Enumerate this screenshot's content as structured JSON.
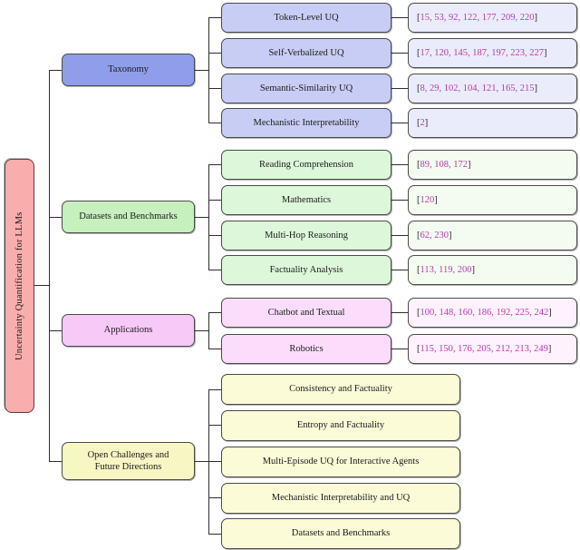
{
  "root": {
    "label": "Uncertainty Quantification for LLMs",
    "color": "#f9adad"
  },
  "categories": [
    {
      "id": "taxonomy",
      "label": "Taxonomy",
      "color": "#8e9ee8",
      "leaf_color": "#c8cdf5",
      "cite_color": "#eaecfb",
      "children": [
        {
          "label": "Token-Level UQ",
          "citations": "[15, 53, 92, 122, 177, 209, 220]"
        },
        {
          "label": "Self-Verbalized UQ",
          "citations": "[17, 120, 145, 187, 197, 223, 227]"
        },
        {
          "label": "Semantic-Similarity UQ",
          "citations": "[8, 29, 102, 104, 121, 165, 215]"
        },
        {
          "label": "Mechanistic Interpretability",
          "citations": "[2]"
        }
      ]
    },
    {
      "id": "datasets",
      "label": "Datasets and Benchmarks",
      "color": "#c6f0bd",
      "leaf_color": "#ddf7da",
      "cite_color": "#f4fcf2",
      "children": [
        {
          "label": "Reading Comprehension",
          "citations": "[89, 108, 172]"
        },
        {
          "label": "Mathematics",
          "citations": "[120]"
        },
        {
          "label": "Multi-Hop Reasoning",
          "citations": "[62, 230]"
        },
        {
          "label": "Factuality Analysis",
          "citations": "[113, 119, 200]"
        }
      ]
    },
    {
      "id": "applications",
      "label": "Applications",
      "color": "#f7c9f7",
      "leaf_color": "#fbddfb",
      "cite_color": "#fdf2fd",
      "children": [
        {
          "label": "Chatbot and Textual",
          "citations": "[100, 148, 160, 186, 192, 225, 242]"
        },
        {
          "label": "Robotics",
          "citations": "[115, 150, 176, 205, 212, 213, 249]"
        }
      ]
    },
    {
      "id": "open_challenges",
      "label": "Open Challenges and\nFuture Directions",
      "label_line1": "Open Challenges and",
      "label_line2": "Future Directions",
      "color": "#f7f7c4",
      "leaf_color": "#fbfbd8",
      "children": [
        {
          "label": "Consistency and Factuality"
        },
        {
          "label": "Entropy and Factuality"
        },
        {
          "label": "Multi-Episode UQ for Interactive Agents"
        },
        {
          "label": "Mechanistic Interpretability and UQ"
        },
        {
          "label": "Datasets and Benchmarks"
        }
      ]
    }
  ],
  "style": {
    "citation_number_color": "#b23ca8",
    "line_color": "#2e2e2e",
    "border_color": "#4a4a4a"
  }
}
